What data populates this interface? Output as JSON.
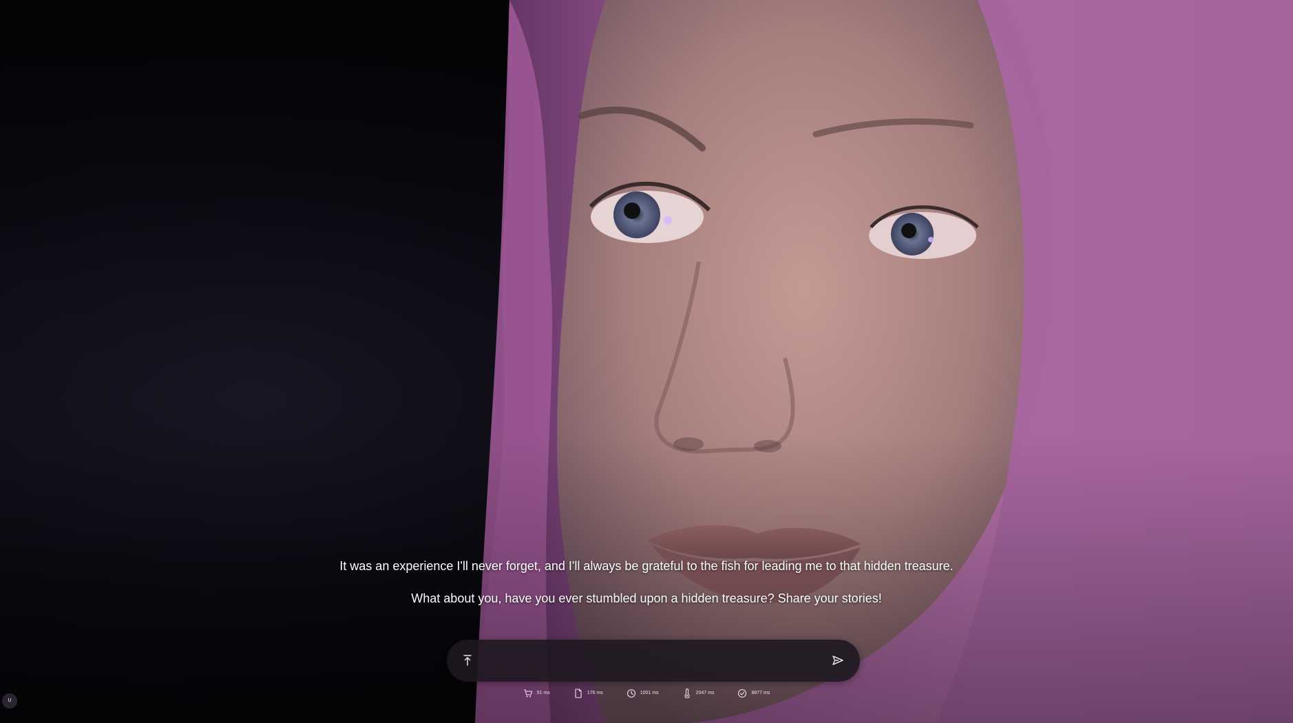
{
  "scene": {
    "avatar": "pink-haired-woman-avatar-closeup"
  },
  "subtitles": {
    "line1": "It was an experience I'll never forget, and I'll always be grateful to the fish for leading me to that hidden treasure.",
    "line2": "What about you, have you ever stumbled upon a hidden treasure? Share your stories!"
  },
  "composer": {
    "value": "",
    "placeholder": "",
    "attach_icon": "upload-icon",
    "send_icon": "send-icon"
  },
  "metrics": [
    {
      "icon": "cart-icon",
      "value": "51 ms"
    },
    {
      "icon": "document-icon",
      "value": "176 ms"
    },
    {
      "icon": "clock-icon",
      "value": "1001 ms"
    },
    {
      "icon": "thermometer-icon",
      "value": "2047 ms"
    },
    {
      "icon": "check-circle-icon",
      "value": "8877 ms"
    }
  ],
  "user_badge": {
    "label": "U"
  },
  "colors": {
    "background": "#050407",
    "hair": "#b06aa6",
    "skin": "#b18a86",
    "composer_bg": "#1e1821",
    "text": "#ffffff"
  }
}
